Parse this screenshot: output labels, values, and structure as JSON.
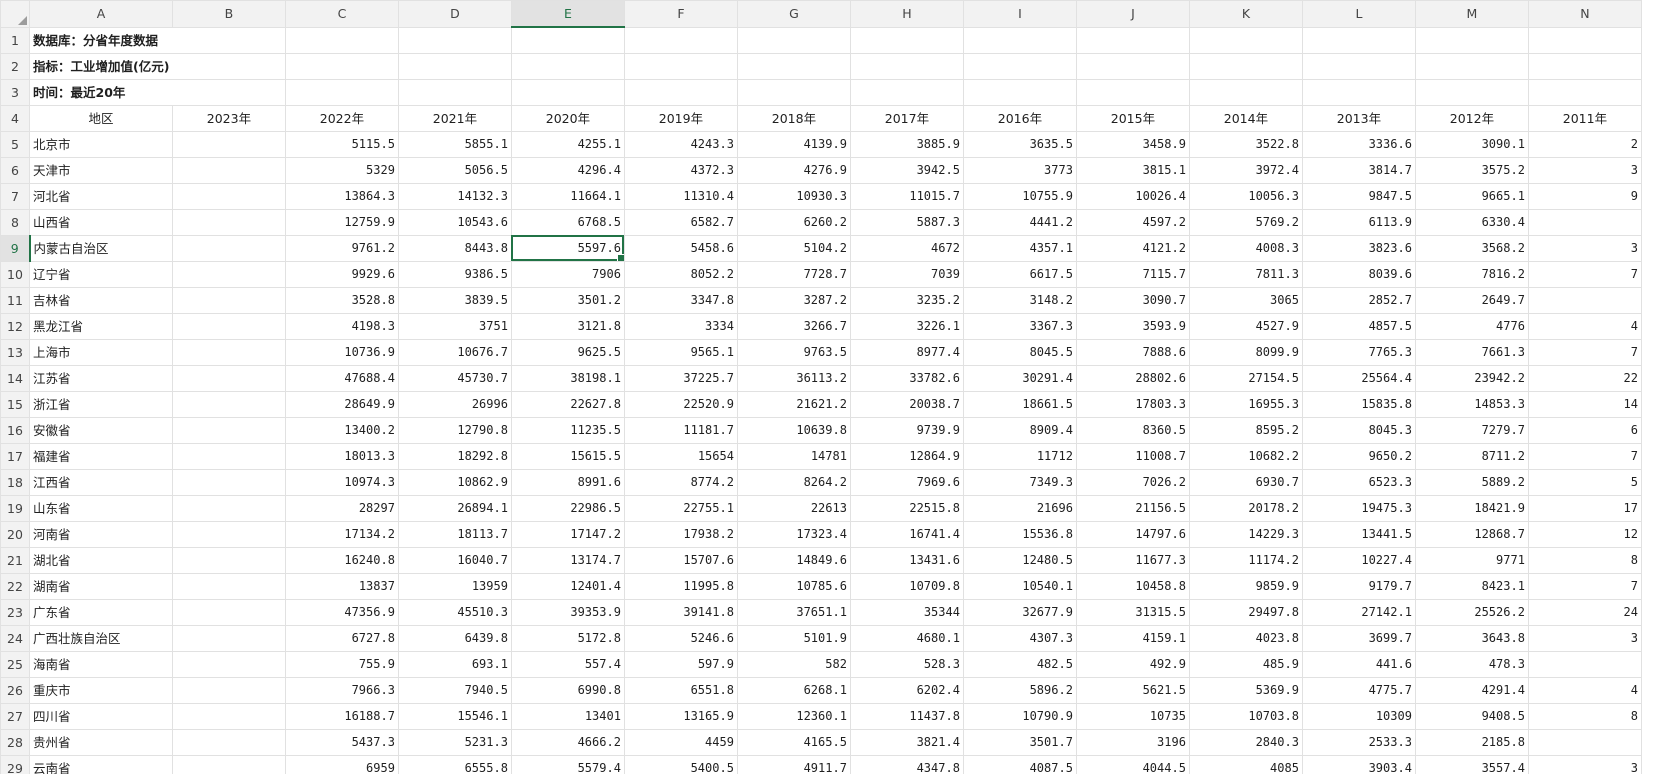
{
  "sheet": {
    "columns": [
      "A",
      "B",
      "C",
      "D",
      "E",
      "F",
      "G",
      "H",
      "I",
      "J",
      "K",
      "L",
      "M",
      "N"
    ],
    "active_column": "E",
    "active_row": 9,
    "info_rows": [
      {
        "row": 1,
        "text": "数据库：分省年度数据"
      },
      {
        "row": 2,
        "text": "指标：工业增加值(亿元)"
      },
      {
        "row": 3,
        "text": "时间：最近20年"
      }
    ],
    "header_row": {
      "row": 4,
      "cells": [
        "地区",
        "2023年",
        "2022年",
        "2021年",
        "2020年",
        "2019年",
        "2018年",
        "2017年",
        "2016年",
        "2015年",
        "2014年",
        "2013年",
        "2012年",
        "2011年"
      ]
    },
    "data_rows": [
      {
        "row": 5,
        "cells": [
          "北京市",
          "",
          "5115.5",
          "5855.1",
          "4255.1",
          "4243.3",
          "4139.9",
          "3885.9",
          "3635.5",
          "3458.9",
          "3522.8",
          "3336.6",
          "3090.1",
          "2"
        ]
      },
      {
        "row": 6,
        "cells": [
          "天津市",
          "",
          "5329",
          "5056.5",
          "4296.4",
          "4372.3",
          "4276.9",
          "3942.5",
          "3773",
          "3815.1",
          "3972.4",
          "3814.7",
          "3575.2",
          "3"
        ]
      },
      {
        "row": 7,
        "cells": [
          "河北省",
          "",
          "13864.3",
          "14132.3",
          "11664.1",
          "11310.4",
          "10930.3",
          "11015.7",
          "10755.9",
          "10026.4",
          "10056.3",
          "9847.5",
          "9665.1",
          "9"
        ]
      },
      {
        "row": 8,
        "cells": [
          "山西省",
          "",
          "12759.9",
          "10543.6",
          "6768.5",
          "6582.7",
          "6260.2",
          "5887.3",
          "4441.2",
          "4597.2",
          "5769.2",
          "6113.9",
          "6330.4",
          ""
        ]
      },
      {
        "row": 9,
        "cells": [
          "内蒙古自治区",
          "",
          "9761.2",
          "8443.8",
          "5597.6",
          "5458.6",
          "5104.2",
          "4672",
          "4357.1",
          "4121.2",
          "4008.3",
          "3823.6",
          "3568.2",
          "3"
        ]
      },
      {
        "row": 10,
        "cells": [
          "辽宁省",
          "",
          "9929.6",
          "9386.5",
          "7906",
          "8052.2",
          "7728.7",
          "7039",
          "6617.5",
          "7115.7",
          "7811.3",
          "8039.6",
          "7816.2",
          "7"
        ]
      },
      {
        "row": 11,
        "cells": [
          "吉林省",
          "",
          "3528.8",
          "3839.5",
          "3501.2",
          "3347.8",
          "3287.2",
          "3235.2",
          "3148.2",
          "3090.7",
          "3065",
          "2852.7",
          "2649.7",
          ""
        ]
      },
      {
        "row": 12,
        "cells": [
          "黑龙江省",
          "",
          "4198.3",
          "3751",
          "3121.8",
          "3334",
          "3266.7",
          "3226.1",
          "3367.3",
          "3593.9",
          "4527.9",
          "4857.5",
          "4776",
          "4"
        ]
      },
      {
        "row": 13,
        "cells": [
          "上海市",
          "",
          "10736.9",
          "10676.7",
          "9625.5",
          "9565.1",
          "9763.5",
          "8977.4",
          "8045.5",
          "7888.6",
          "8099.9",
          "7765.3",
          "7661.3",
          "7"
        ]
      },
      {
        "row": 14,
        "cells": [
          "江苏省",
          "",
          "47688.4",
          "45730.7",
          "38198.1",
          "37225.7",
          "36113.2",
          "33782.6",
          "30291.4",
          "28802.6",
          "27154.5",
          "25564.4",
          "23942.2",
          "22"
        ]
      },
      {
        "row": 15,
        "cells": [
          "浙江省",
          "",
          "28649.9",
          "26996",
          "22627.8",
          "22520.9",
          "21621.2",
          "20038.7",
          "18661.5",
          "17803.3",
          "16955.3",
          "15835.8",
          "14853.3",
          "14"
        ]
      },
      {
        "row": 16,
        "cells": [
          "安徽省",
          "",
          "13400.2",
          "12790.8",
          "11235.5",
          "11181.7",
          "10639.8",
          "9739.9",
          "8909.4",
          "8360.5",
          "8595.2",
          "8045.3",
          "7279.7",
          "6"
        ]
      },
      {
        "row": 17,
        "cells": [
          "福建省",
          "",
          "18013.3",
          "18292.8",
          "15615.5",
          "15654",
          "14781",
          "12864.9",
          "11712",
          "11008.7",
          "10682.2",
          "9650.2",
          "8711.2",
          "7"
        ]
      },
      {
        "row": 18,
        "cells": [
          "江西省",
          "",
          "10974.3",
          "10862.9",
          "8991.6",
          "8774.2",
          "8264.2",
          "7969.6",
          "7349.3",
          "7026.2",
          "6930.7",
          "6523.3",
          "5889.2",
          "5"
        ]
      },
      {
        "row": 19,
        "cells": [
          "山东省",
          "",
          "28297",
          "26894.1",
          "22986.5",
          "22755.1",
          "22613",
          "22515.8",
          "21696",
          "21156.5",
          "20178.2",
          "19475.3",
          "18421.9",
          "17"
        ]
      },
      {
        "row": 20,
        "cells": [
          "河南省",
          "",
          "17134.2",
          "18113.7",
          "17147.2",
          "17938.2",
          "17323.4",
          "16741.4",
          "15536.8",
          "14797.6",
          "14229.3",
          "13441.5",
          "12868.7",
          "12"
        ]
      },
      {
        "row": 21,
        "cells": [
          "湖北省",
          "",
          "16240.8",
          "16040.7",
          "13174.7",
          "15707.6",
          "14849.6",
          "13431.6",
          "12480.5",
          "11677.3",
          "11174.2",
          "10227.4",
          "9771",
          "8"
        ]
      },
      {
        "row": 22,
        "cells": [
          "湖南省",
          "",
          "13837",
          "13959",
          "12401.4",
          "11995.8",
          "10785.6",
          "10709.8",
          "10540.1",
          "10458.8",
          "9859.9",
          "9179.7",
          "8423.1",
          "7"
        ]
      },
      {
        "row": 23,
        "cells": [
          "广东省",
          "",
          "47356.9",
          "45510.3",
          "39353.9",
          "39141.8",
          "37651.1",
          "35344",
          "32677.9",
          "31315.5",
          "29497.8",
          "27142.1",
          "25526.2",
          "24"
        ]
      },
      {
        "row": 24,
        "cells": [
          "广西壮族自治区",
          "",
          "6727.8",
          "6439.8",
          "5172.8",
          "5246.6",
          "5101.9",
          "4680.1",
          "4307.3",
          "4159.1",
          "4023.8",
          "3699.7",
          "3643.8",
          "3"
        ]
      },
      {
        "row": 25,
        "cells": [
          "海南省",
          "",
          "755.9",
          "693.1",
          "557.4",
          "597.9",
          "582",
          "528.3",
          "482.5",
          "492.9",
          "485.9",
          "441.6",
          "478.3",
          ""
        ]
      },
      {
        "row": 26,
        "cells": [
          "重庆市",
          "",
          "7966.3",
          "7940.5",
          "6990.8",
          "6551.8",
          "6268.1",
          "6202.4",
          "5896.2",
          "5621.5",
          "5369.9",
          "4775.7",
          "4291.4",
          "4"
        ]
      },
      {
        "row": 27,
        "cells": [
          "四川省",
          "",
          "16188.7",
          "15546.1",
          "13401",
          "13165.9",
          "12360.1",
          "11437.8",
          "10790.9",
          "10735",
          "10703.8",
          "10309",
          "9408.5",
          "8"
        ]
      },
      {
        "row": 28,
        "cells": [
          "贵州省",
          "",
          "5437.3",
          "5231.3",
          "4666.2",
          "4459",
          "4165.5",
          "3821.4",
          "3501.7",
          "3196",
          "2840.3",
          "2533.3",
          "2185.8",
          ""
        ]
      },
      {
        "row": 29,
        "cells": [
          "云南省",
          "",
          "6959",
          "6555.8",
          "5579.4",
          "5400.5",
          "4911.7",
          "4347.8",
          "4087.5",
          "4044.5",
          "4085",
          "3903.4",
          "3557.4",
          "3"
        ]
      }
    ]
  },
  "colors": {
    "accent": "#217346",
    "header_bg": "#f2f2f2",
    "gridline": "#e1e1e1"
  }
}
